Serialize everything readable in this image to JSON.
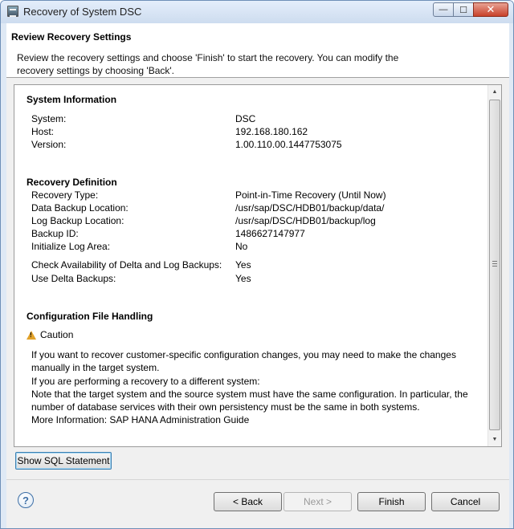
{
  "window": {
    "title": "Recovery of System DSC"
  },
  "window_controls": {
    "minimize": "—",
    "maximize": "☐",
    "close": "✕"
  },
  "header": {
    "title": "Review Recovery Settings",
    "description": "Review the recovery settings and choose 'Finish' to start the recovery. You can modify the recovery settings by choosing 'Back'."
  },
  "system_information": {
    "title": "System Information",
    "rows": [
      {
        "label": "System:",
        "value": "DSC"
      },
      {
        "label": "Host:",
        "value": "192.168.180.162"
      },
      {
        "label": "Version:",
        "value": "1.00.110.00.1447753075"
      }
    ]
  },
  "recovery_definition": {
    "title": "Recovery Definition",
    "rows": [
      {
        "label": "Recovery Type:",
        "value": "Point-in-Time Recovery (Until Now)"
      },
      {
        "label": "Data Backup Location:",
        "value": "/usr/sap/DSC/HDB01/backup/data/"
      },
      {
        "label": "Log Backup Location:",
        "value": "/usr/sap/DSC/HDB01/backup/log"
      },
      {
        "label": "Backup ID:",
        "value": "1486627147977"
      },
      {
        "label": "Initialize Log Area:",
        "value": "No"
      },
      {
        "label": "Check Availability of Delta and Log Backups:",
        "value": "Yes"
      },
      {
        "label": "Use Delta Backups:",
        "value": "Yes"
      }
    ]
  },
  "configuration": {
    "title": "Configuration File Handling",
    "caution_label": "Caution",
    "paragraph": [
      "If you want to recover customer-specific configuration changes, you may need to make the changes manually in the target system.",
      "If you are performing a recovery to a different system:",
      "Note that the target system and the source system must have the same configuration. In particular, the number of database services with their own persistency must be the same in both systems.",
      "More Information: SAP HANA Administration Guide"
    ]
  },
  "buttons": {
    "show_sql": "Show SQL Statement",
    "help": "?",
    "back": "< Back",
    "next": "Next >",
    "finish": "Finish",
    "cancel": "Cancel"
  }
}
